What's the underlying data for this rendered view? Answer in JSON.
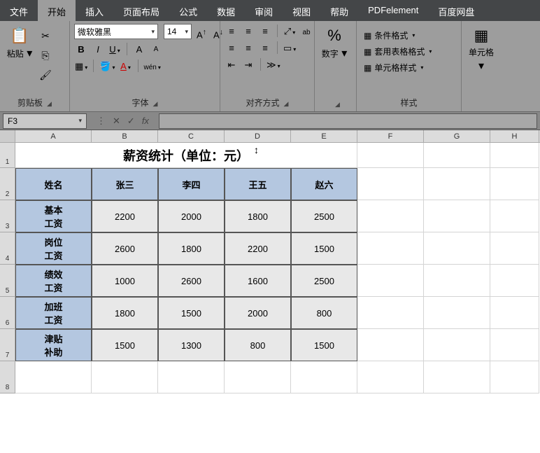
{
  "menu": {
    "items": [
      "文件",
      "开始",
      "插入",
      "页面布局",
      "公式",
      "数据",
      "审阅",
      "视图",
      "帮助",
      "PDFelement",
      "百度网盘"
    ],
    "active": 1
  },
  "ribbon": {
    "clipboard": {
      "paste": "粘贴",
      "label": "剪贴板"
    },
    "font": {
      "name": "微软雅黑",
      "size": "14",
      "label": "字体"
    },
    "align": {
      "label": "对齐方式"
    },
    "number": {
      "btn": "数字",
      "label": "数字"
    },
    "styles": {
      "cond": "条件格式",
      "table": "套用表格格式",
      "cell": "单元格样式",
      "label": "样式"
    },
    "cells": {
      "btn": "单元格"
    }
  },
  "formula": {
    "namebox": "F3",
    "fx": "fx"
  },
  "sheet": {
    "cols": [
      "A",
      "B",
      "C",
      "D",
      "E",
      "F",
      "G",
      "H"
    ],
    "title": "薪资统计（单位：元）",
    "headers": [
      "姓名",
      "张三",
      "李四",
      "王五",
      "赵六"
    ],
    "rows": [
      {
        "label": "基本\n工资",
        "v": [
          "2200",
          "2000",
          "1800",
          "2500"
        ]
      },
      {
        "label": "岗位\n工资",
        "v": [
          "2600",
          "1800",
          "2200",
          "1500"
        ]
      },
      {
        "label": "绩效\n工资",
        "v": [
          "1000",
          "2600",
          "1600",
          "2500"
        ]
      },
      {
        "label": "加班\n工资",
        "v": [
          "1800",
          "1500",
          "2000",
          "800"
        ]
      },
      {
        "label": "津贴\n补助",
        "v": [
          "1500",
          "1300",
          "800",
          "1500"
        ]
      }
    ],
    "rownums": [
      "1",
      "2",
      "3",
      "4",
      "5",
      "6",
      "7",
      "8"
    ]
  },
  "chart_data": {
    "type": "table",
    "title": "薪资统计（单位：元）",
    "columns": [
      "姓名",
      "张三",
      "李四",
      "王五",
      "赵六"
    ],
    "rows": [
      [
        "基本工资",
        2200,
        2000,
        1800,
        2500
      ],
      [
        "岗位工资",
        2600,
        1800,
        2200,
        1500
      ],
      [
        "绩效工资",
        1000,
        2600,
        1600,
        2500
      ],
      [
        "加班工资",
        1800,
        1500,
        2000,
        800
      ],
      [
        "津贴补助",
        1500,
        1300,
        800,
        1500
      ]
    ]
  }
}
